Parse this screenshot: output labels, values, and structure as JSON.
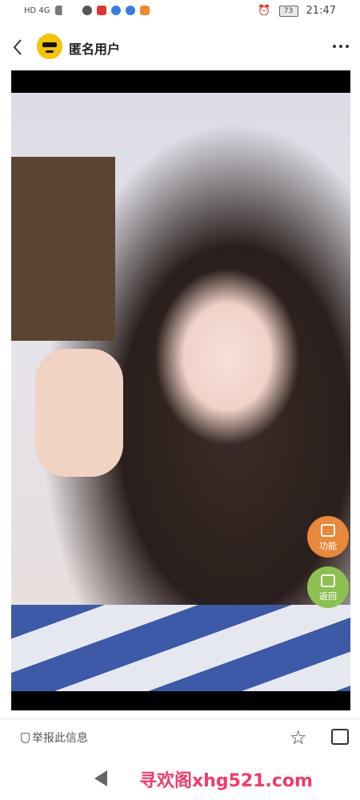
{
  "status_bar": {
    "left": "HD 4G",
    "battery": "73",
    "time": "21:47"
  },
  "header": {
    "title": "匿名用户"
  },
  "fab": {
    "function_label": "功能",
    "back_label": "返回"
  },
  "footer": {
    "report_label": "举报此信息"
  },
  "watermark": "寻欢阁xhg521.com",
  "colors": {
    "function": "#e8883a",
    "back": "#8cc151",
    "watermark": "#f03c6b",
    "avatar": "#f5c400"
  }
}
